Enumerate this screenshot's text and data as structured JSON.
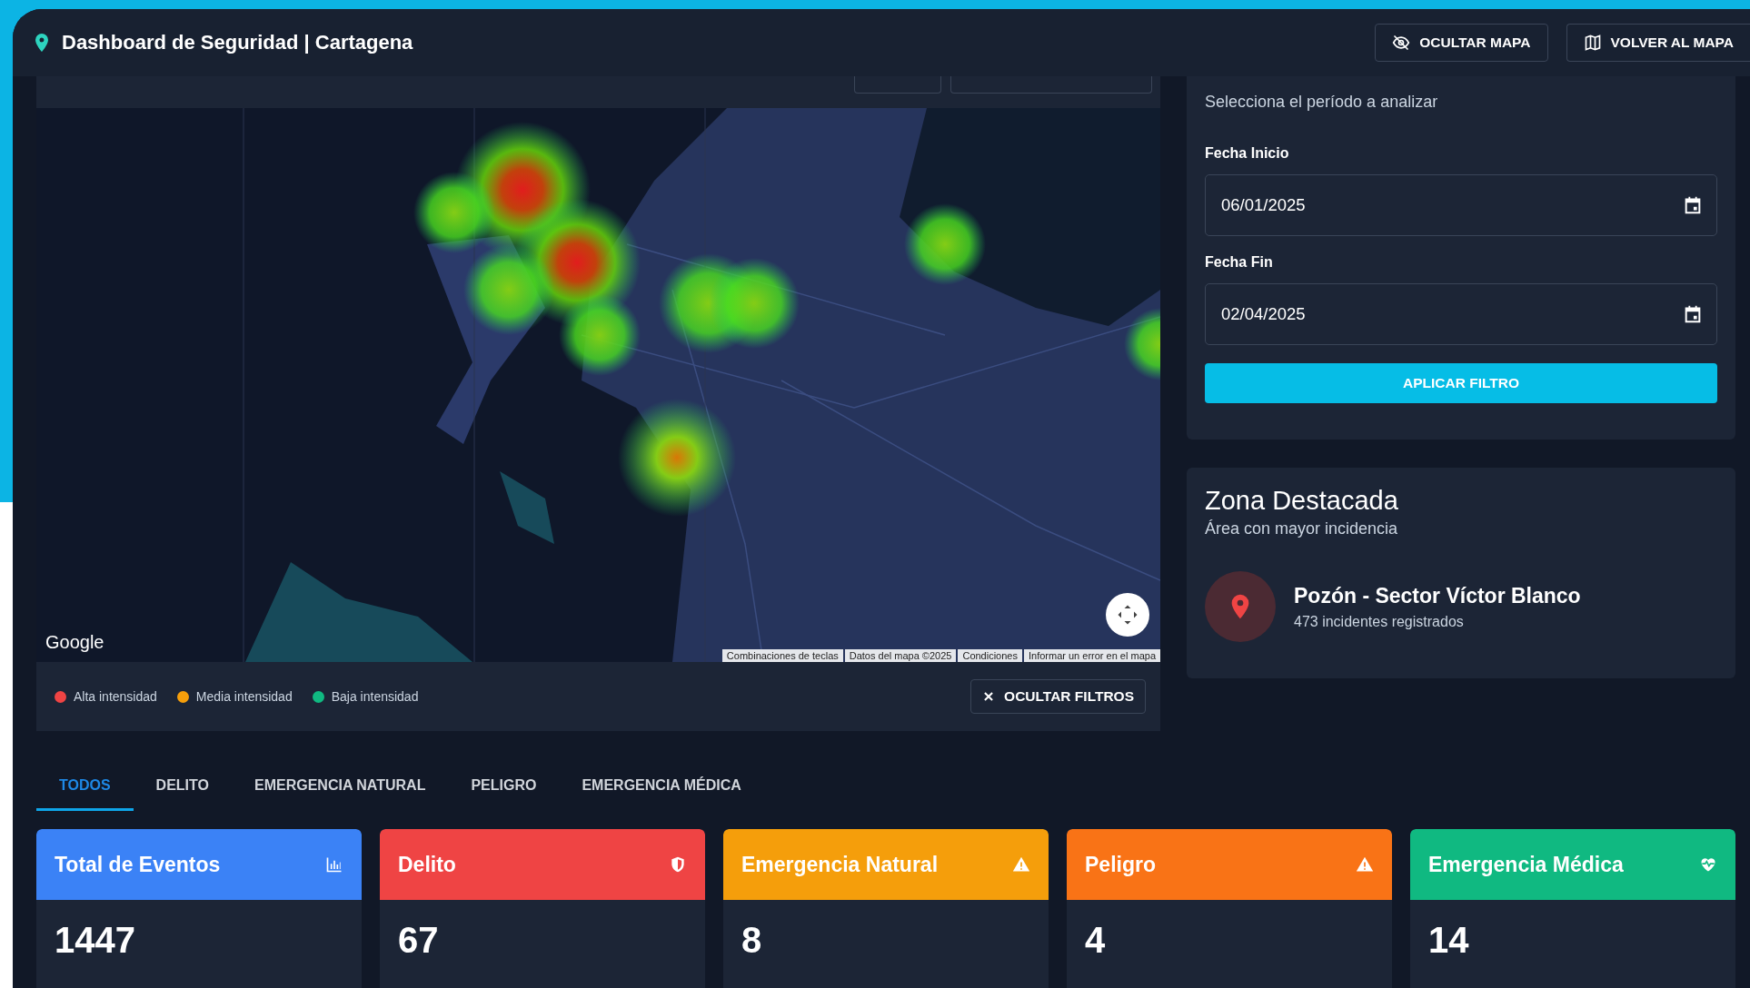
{
  "header": {
    "title": "Dashboard de Seguridad | Cartagena",
    "buttons": [
      {
        "label": "OCULTAR MAPA"
      },
      {
        "label": "VOLVER AL MAPA"
      }
    ]
  },
  "map": {
    "logo": "Google",
    "attribution": [
      "Combinaciones de teclas",
      "Datos del mapa ©2025",
      "Condiciones",
      "Informar un error en el mapa"
    ],
    "legend": [
      {
        "label": "Alta intensidad",
        "color": "#ef4444"
      },
      {
        "label": "Media intensidad",
        "color": "#f59e0b"
      },
      {
        "label": "Baja intensidad",
        "color": "#10b981"
      }
    ],
    "hide_filters_button": "OCULTAR FILTROS"
  },
  "date_range": {
    "subtitle": "Selecciona el período a analizar",
    "fields": [
      {
        "label": "Fecha Inicio",
        "value": "06/01/2025"
      },
      {
        "label": "Fecha Fin",
        "value": "02/04/2025"
      }
    ],
    "button": "APLICAR FILTRO"
  },
  "highlight_zone": {
    "title": "Zona Destacada",
    "subtitle": "Área con mayor incidencia",
    "name": "Pozón - Sector Víctor Blanco",
    "detail": "473 incidentes registrados"
  },
  "tabs": [
    {
      "label": "TODOS",
      "selected": true
    },
    {
      "label": "DELITO",
      "selected": false
    },
    {
      "label": "EMERGENCIA NATURAL",
      "selected": false
    },
    {
      "label": "PELIGRO",
      "selected": false
    },
    {
      "label": "EMERGENCIA MÉDICA",
      "selected": false
    }
  ],
  "cards": [
    {
      "kind": "total",
      "title": "Total de Eventos",
      "value": "1447"
    },
    {
      "kind": "crime",
      "title": "Delito",
      "value": "67"
    },
    {
      "kind": "natural",
      "title": "Emergencia Natural",
      "value": "8"
    },
    {
      "kind": "danger",
      "title": "Peligro",
      "value": "4"
    },
    {
      "kind": "medical",
      "title": "Emergencia Médica",
      "value": "14"
    }
  ]
}
